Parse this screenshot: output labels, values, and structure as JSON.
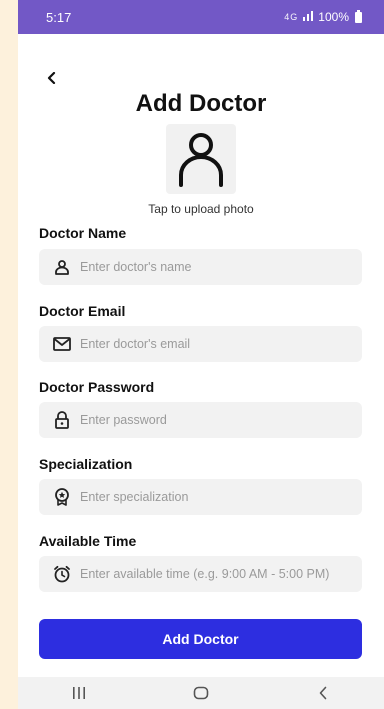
{
  "status_bar": {
    "time": "5:17",
    "network": "4G",
    "battery": "100%"
  },
  "page": {
    "title": "Add Doctor",
    "upload_hint": "Tap to upload photo"
  },
  "form": {
    "fields": [
      {
        "label": "Doctor Name",
        "placeholder": "Enter doctor's name",
        "icon": "user-icon"
      },
      {
        "label": "Doctor Email",
        "placeholder": "Enter doctor's email",
        "icon": "mail-icon"
      },
      {
        "label": "Doctor Password",
        "placeholder": "Enter password",
        "icon": "lock-icon"
      },
      {
        "label": "Specialization",
        "placeholder": "Enter specialization",
        "icon": "badge-icon"
      },
      {
        "label": "Available Time",
        "placeholder": "Enter available time (e.g. 9:00 AM - 5:00 PM)",
        "icon": "alarm-clock-icon"
      }
    ],
    "submit_label": "Add Doctor"
  },
  "colors": {
    "status_bar": "#7258c6",
    "accent": "#2d2ee0",
    "field_bg": "#f2f2f2"
  }
}
